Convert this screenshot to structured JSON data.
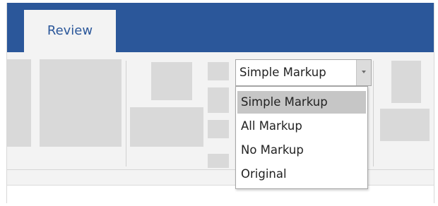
{
  "tabs": {
    "active_tab_label": "Review"
  },
  "markup_selector": {
    "selected_value": "Simple Markup",
    "options": [
      "Simple Markup",
      "All Markup",
      "No Markup",
      "Original"
    ],
    "highlighted_option": "Simple Markup"
  },
  "colors": {
    "ribbon_tab_bar": "#2b579a",
    "ribbon_body": "#f3f3f3",
    "placeholder_block": "#d9d9d9",
    "highlighted_option_bg": "#c6c6c6"
  },
  "icons": [
    "dropdown-arrow-icon"
  ]
}
